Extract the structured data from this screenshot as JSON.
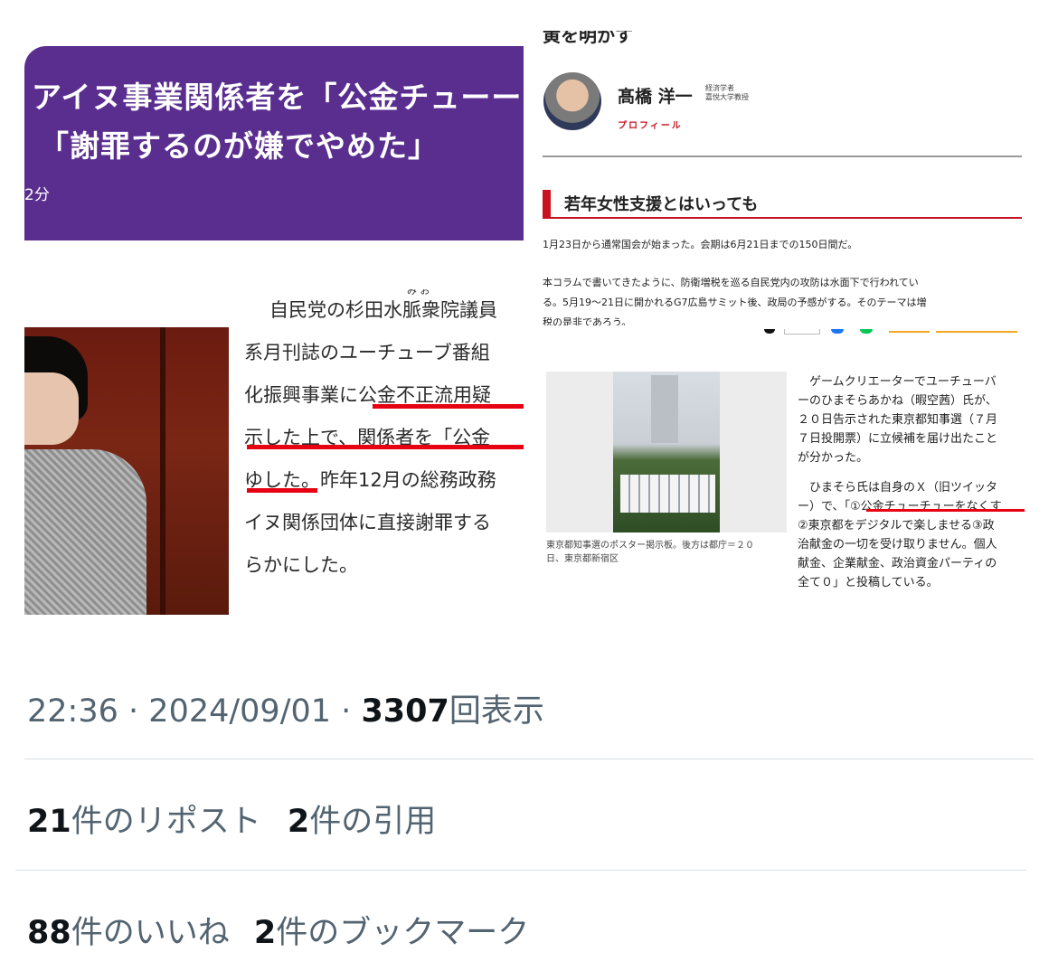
{
  "left_image": {
    "headline_line1": "アイヌ事業関係者を「公金チューーチ",
    "headline_line2": "「謝罪するのが嫌でやめた」",
    "read_time": "2分",
    "article_lines": [
      "自民党の杉田水脈衆院議員",
      "系月刊誌のユーチューブ番組",
      "化振興事業に公金不正流用疑",
      "示した上で、関係者を「公金",
      "ゆした。昨年12月の総務政務",
      "イヌ関係団体に直接謝罪する",
      "らかにした。"
    ],
    "ruby": "み お"
  },
  "right_top_image": {
    "cut_heading": "黄を明かす",
    "author_name": "髙橋 洋一",
    "author_title1": "経済学者",
    "author_title2": "嘉悦大学教授",
    "profile_link": "プロフィール",
    "section_heading": "若年女性支援とはいっても",
    "para1": "1月23日から通常国会が始まった。会期は6月21日までの150日間だ。",
    "para2_line1": "本コラムで書いてきたように、防衛増税を巡る自民党内の攻防は水面下で行われてい",
    "para2_line2": "る。5月19〜21日に開かれるG7広島サミット後、政局の予感がする。そのテーマは増",
    "para2_line3": "税の是非であろう。"
  },
  "right_bottom_image": {
    "photo_caption_line1": "東京都知事選のポスター掲示板。後方は都庁＝２０",
    "photo_caption_line2": "日、東京都新宿区",
    "body_lines": [
      "　ゲームクリエーターでユーチューバ",
      "ーのひまそらあかね（暇空茜）氏が、",
      "２０日告示された東京都知事選（７月",
      "７日投開票）に立候補を届け出たこと",
      "が分かった。",
      "　ひまそら氏は自身のＸ（旧ツイッタ",
      "ー）で、「①公金チューチューをなくす",
      "②東京都をデジタルで楽しませる③政",
      "治献金の一切を受け取りません。個人",
      "献金、企業献金、政治資金パーティの",
      "全て０」と投稿している。"
    ]
  },
  "tweet_meta": {
    "time": "22:36",
    "separator": "·",
    "date": "2024/09/01",
    "views_count": "3307",
    "views_label": "回表示"
  },
  "stats": {
    "reposts_count": "21",
    "reposts_label": "件のリポスト",
    "quotes_count": "2",
    "quotes_label": "件の引用",
    "likes_count": "88",
    "likes_label": "件のいいね",
    "bookmarks_count": "2",
    "bookmarks_label": "件のブックマーク"
  },
  "colors": {
    "purple_banner": "#5a2e8f",
    "underline_red": "#e60012",
    "section_red": "#c8121f",
    "muted_text": "#536471",
    "primary_text": "#0f1419"
  }
}
